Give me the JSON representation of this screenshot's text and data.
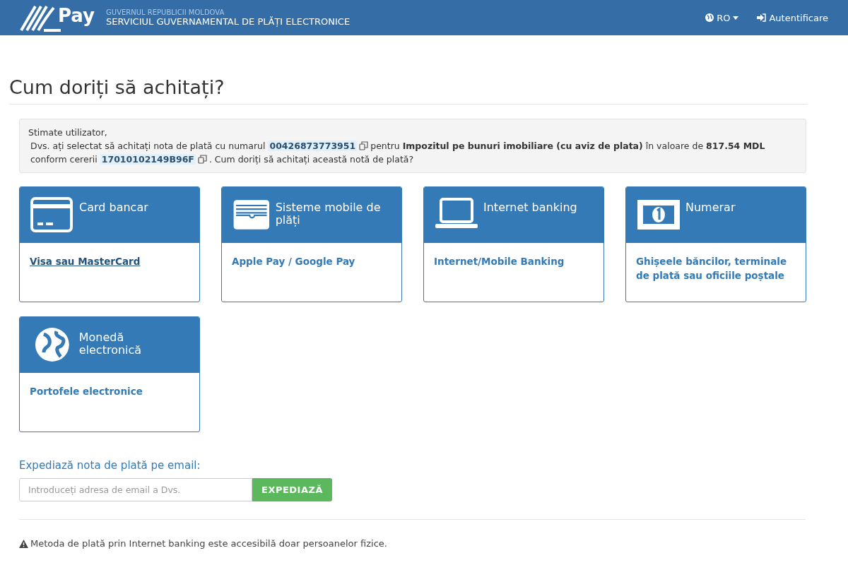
{
  "header": {
    "logo_text": "Pay",
    "org": "GUVERNUL REPUBLICII MOLDOVA",
    "service": "SERVICIUL GUVERNAMENTAL DE PLĂȚI ELECTRONICE",
    "language": "RO",
    "login": "Autentificare"
  },
  "title": "Cum doriți să achitați?",
  "notice": {
    "greeting": "Stimate utilizator,",
    "segments": [
      {
        "kind": "text",
        "text": "Dvs. ați selectat să achitați nota de plată cu numarul"
      },
      {
        "kind": "code",
        "text": "00426873773951"
      },
      {
        "kind": "copy"
      },
      {
        "kind": "text",
        "text": "pentru **Impozitul pe bunuri imobiliare (cu aviz de plata)** în valoare de **817.54 MDL**"
      },
      {
        "kind": "break"
      },
      {
        "kind": "text",
        "text": "conform cererii"
      },
      {
        "kind": "code",
        "text": "17010102149B96F"
      },
      {
        "kind": "copy"
      },
      {
        "kind": "text",
        "text": ". Cum doriți să achitați această notă de plată?"
      }
    ]
  },
  "methods": [
    {
      "kind": "card",
      "title": "Card bancar",
      "option": "Visa sau MasterCard",
      "hovered": true
    },
    {
      "kind": "wallet",
      "title": "Sisteme mobile de plăți",
      "option": "Apple Pay / Google Pay",
      "hovered": false
    },
    {
      "kind": "laptop",
      "title": "Internet banking",
      "option": "Internet/Mobile Banking",
      "hovered": false
    },
    {
      "kind": "cash",
      "title": "Numerar",
      "option": "Ghișeele băncilor, terminale de plată sau oficiile poștale",
      "hovered": false
    },
    {
      "kind": "globe",
      "title": "Monedă electronică",
      "option": "Portofele electronice",
      "hovered": false
    }
  ],
  "email": {
    "label": "Expediază nota de plată pe email:",
    "placeholder": "Introduceți adresa de email a Dvs.",
    "button": "EXPEDIAZĂ"
  },
  "footnote": "Metoda de plată prin Internet banking este accesibilă doar persoanelor fizice."
}
